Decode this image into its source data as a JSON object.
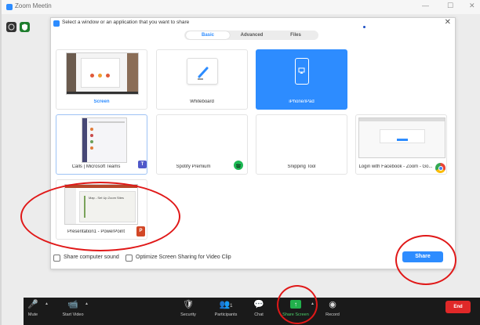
{
  "zoom_window": {
    "title": "Zoom Meetin",
    "minimize": "—",
    "maximize": "☐",
    "close": "✕"
  },
  "dialog": {
    "title": "Select a window or an application that you want to share",
    "close": "✕",
    "tabs": [
      {
        "label": "Basic",
        "active": true
      },
      {
        "label": "Advanced",
        "active": false
      },
      {
        "label": "Files",
        "active": false
      }
    ],
    "tiles": [
      {
        "label": "Screen",
        "kind": "screen"
      },
      {
        "label": "Whiteboard",
        "kind": "whiteboard"
      },
      {
        "label": "iPhone/iPad",
        "kind": "ipad"
      },
      {
        "label": "Calls | Microsoft Teams",
        "kind": "teams"
      },
      {
        "label": "Spotify Premium",
        "kind": "spotify"
      },
      {
        "label": "Snipping Tool",
        "kind": "snipping"
      },
      {
        "label": "Login with Facebook - Zoom - Go...",
        "kind": "chrome"
      },
      {
        "label": "Presentation1 - PowerPoint",
        "kind": "powerpoint"
      }
    ],
    "slide_text": "Map - Set Up Zoom Sites",
    "footer": {
      "share_sound": "Share computer sound",
      "optimize": "Optimize Screen Sharing for Video Clip",
      "share_button": "Share"
    }
  },
  "toolbar": {
    "items": [
      {
        "label": "Mute",
        "icon": "microphone-icon"
      },
      {
        "label": "Start Video",
        "icon": "video-off-icon"
      },
      {
        "label": "Security",
        "icon": "shield-icon"
      },
      {
        "label": "Participants",
        "icon": "participants-icon",
        "count": "1"
      },
      {
        "label": "Chat",
        "icon": "chat-icon"
      },
      {
        "label": "Share Screen",
        "icon": "share-screen-icon"
      },
      {
        "label": "Record",
        "icon": "record-icon"
      }
    ],
    "end_label": "End"
  },
  "colors": {
    "accent": "#2d8cff",
    "annotation": "#e01818",
    "toolbar": "#1a1a1a",
    "end": "#e02828"
  }
}
